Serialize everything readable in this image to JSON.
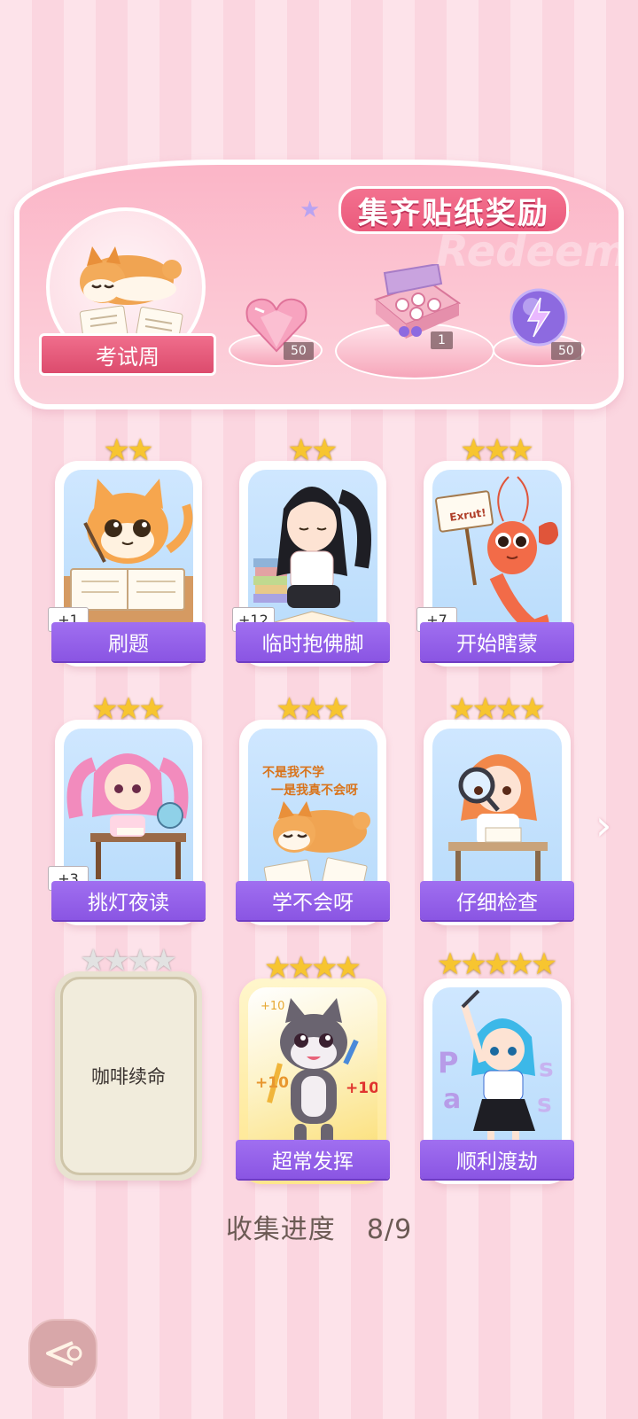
{
  "banner": {
    "title": "集齐贴纸奖励",
    "event_name": "考试周",
    "rewards": [
      {
        "icon": "heart-gem-icon",
        "qty": "50"
      },
      {
        "icon": "gift-box-icon",
        "qty": "1"
      },
      {
        "icon": "lightning-orb-icon",
        "qty": "50"
      }
    ]
  },
  "stickers": [
    {
      "name": "刷题",
      "stars": 2,
      "badge": "+1",
      "state": "collected"
    },
    {
      "name": "临时抱佛脚",
      "stars": 2,
      "badge": "+12",
      "state": "collected"
    },
    {
      "name": "开始瞎蒙",
      "stars": 3,
      "badge": "+7",
      "state": "collected",
      "sign_text": "Exrut!"
    },
    {
      "name": "挑灯夜读",
      "stars": 3,
      "badge": "+3",
      "state": "collected"
    },
    {
      "name": "学不会呀",
      "stars": 3,
      "badge": "",
      "state": "collected",
      "art_text": [
        "不是我不学",
        "一是我真不会呀"
      ]
    },
    {
      "name": "仔细检查",
      "stars": 4,
      "badge": "",
      "state": "collected"
    },
    {
      "name": "咖啡续命",
      "stars": 4,
      "badge": "",
      "state": "locked"
    },
    {
      "name": "超常发挥",
      "stars": 4,
      "badge": "",
      "state": "gold",
      "art_text": [
        "+10",
        "+10",
        "+10"
      ]
    },
    {
      "name": "顺利渡劫",
      "stars": 5,
      "badge": "",
      "state": "collected"
    }
  ],
  "progress": {
    "label": "收集进度",
    "value": "8/9"
  },
  "colors": {
    "accent_pink": "#eb5a7c",
    "label_purple": "#8a55e3",
    "star_gold": "#f7c530"
  }
}
